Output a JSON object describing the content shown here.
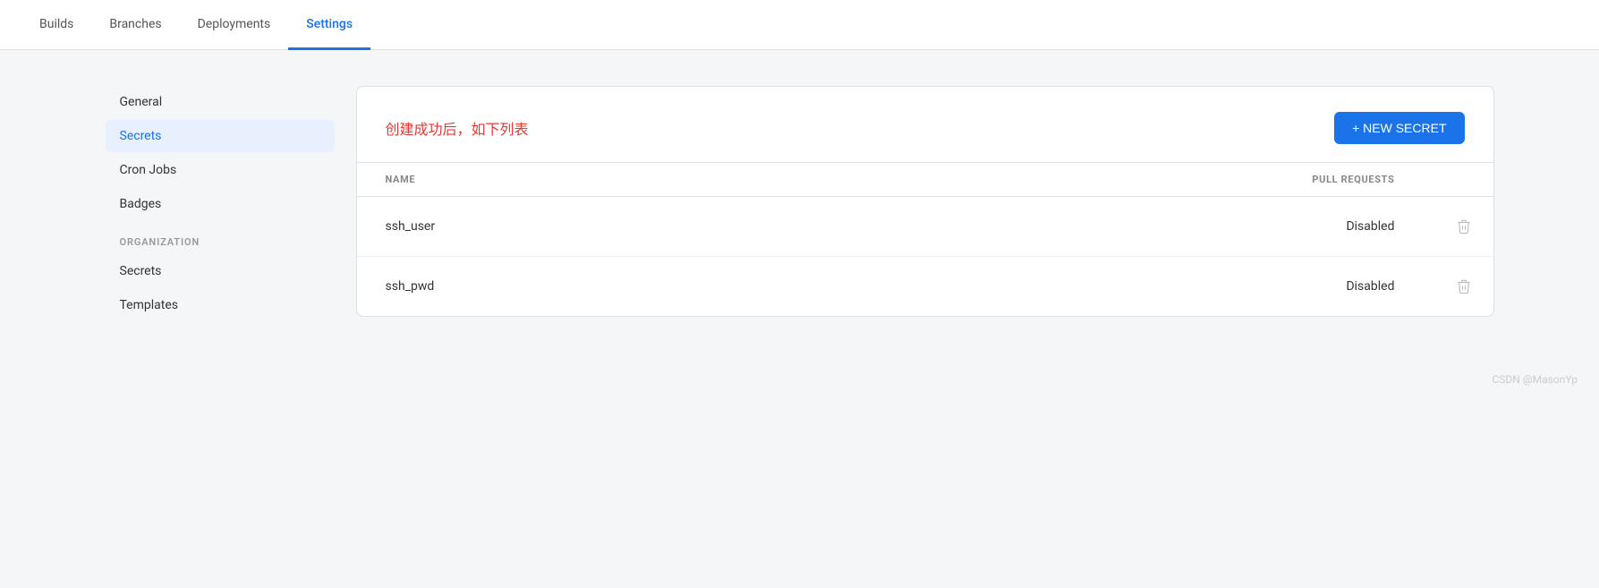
{
  "nav": {
    "tabs": [
      {
        "id": "builds",
        "label": "Builds",
        "active": false
      },
      {
        "id": "branches",
        "label": "Branches",
        "active": false
      },
      {
        "id": "deployments",
        "label": "Deployments",
        "active": false
      },
      {
        "id": "settings",
        "label": "Settings",
        "active": true
      }
    ]
  },
  "sidebar": {
    "items": [
      {
        "id": "general",
        "label": "General",
        "active": false,
        "section": null
      },
      {
        "id": "secrets",
        "label": "Secrets",
        "active": true,
        "section": null
      },
      {
        "id": "cron-jobs",
        "label": "Cron Jobs",
        "active": false,
        "section": null
      },
      {
        "id": "badges",
        "label": "Badges",
        "active": false,
        "section": null
      }
    ],
    "organization_label": "ORGANIZATION",
    "org_items": [
      {
        "id": "org-secrets",
        "label": "Secrets",
        "active": false
      },
      {
        "id": "org-templates",
        "label": "Templates",
        "active": false
      }
    ]
  },
  "card": {
    "title": "创建成功后，如下列表",
    "new_secret_button": "+ NEW SECRET",
    "table": {
      "columns": [
        {
          "id": "name",
          "label": "NAME"
        },
        {
          "id": "pull-requests",
          "label": "PULL REQUESTS"
        }
      ],
      "rows": [
        {
          "id": "row-1",
          "name": "ssh_user",
          "pull_requests": "Disabled"
        },
        {
          "id": "row-2",
          "name": "ssh_pwd",
          "pull_requests": "Disabled"
        }
      ]
    }
  },
  "footer": {
    "text": "CSDN @MasonYp"
  }
}
